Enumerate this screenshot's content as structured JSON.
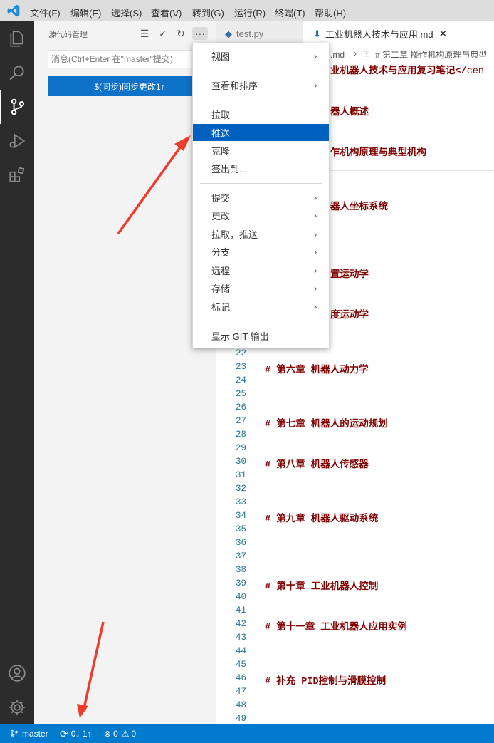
{
  "menubar": {
    "items": [
      "文件(F)",
      "编辑(E)",
      "选择(S)",
      "查看(V)",
      "转到(G)",
      "运行(R)",
      "终端(T)",
      "帮助(H)"
    ]
  },
  "sidebar": {
    "title": "源代码管理",
    "message_placeholder": "消息(Ctrl+Enter 在\"master\"提交)",
    "sync_button": "$(同步)同步更改1↑"
  },
  "tabs": [
    {
      "label": "test.py",
      "active": false
    },
    {
      "label": "工业机器人技术与应用.md",
      "active": true
    }
  ],
  "breadcrumb": {
    "file": "用.md",
    "separator": "›",
    "section": "# 第二章 操作机构原理与典型"
  },
  "editor": {
    "visible_fragments": [
      {
        "text": "业机器人技术与应用复习笔记</",
        "tail": "cen"
      },
      {
        "text": "器人概述"
      },
      {
        "text": "乍机构原理与典型机构"
      },
      {
        "text": "器人坐标系统"
      },
      {
        "text": "置运动学"
      },
      {
        "text": "度运动学"
      }
    ],
    "lines": [
      {
        "n": "22",
        "code": ""
      },
      {
        "n": "23",
        "code": "# 第六章 机器人动力学"
      },
      {
        "n": "24",
        "code": ""
      },
      {
        "n": "25",
        "code": ""
      },
      {
        "n": "26",
        "code": ""
      },
      {
        "n": "27",
        "code": "# 第七章 机器人的运动规划"
      },
      {
        "n": "28",
        "code": ""
      },
      {
        "n": "29",
        "code": ""
      },
      {
        "n": "30",
        "code": "# 第八章 机器人传感器"
      },
      {
        "n": "31",
        "code": ""
      },
      {
        "n": "32",
        "code": ""
      },
      {
        "n": "33",
        "code": ""
      },
      {
        "n": "34",
        "code": "# 第九章 机器人驱动系统"
      },
      {
        "n": "35",
        "code": ""
      },
      {
        "n": "36",
        "code": ""
      },
      {
        "n": "37",
        "code": ""
      },
      {
        "n": "38",
        "code": ""
      },
      {
        "n": "39",
        "code": "# 第十章 工业机器人控制"
      },
      {
        "n": "40",
        "code": ""
      },
      {
        "n": "41",
        "code": ""
      },
      {
        "n": "42",
        "code": "# 第十一章 工业机器人应用实例"
      },
      {
        "n": "43",
        "code": ""
      },
      {
        "n": "44",
        "code": ""
      },
      {
        "n": "45",
        "code": ""
      },
      {
        "n": "46",
        "code": "# 补充   PID控制与滑膜控制"
      },
      {
        "n": "47",
        "code": ""
      },
      {
        "n": "48",
        "code": ""
      },
      {
        "n": "49",
        "code": ""
      }
    ]
  },
  "context_menu": {
    "items": [
      {
        "label": "视图",
        "submenu": true
      },
      {
        "label": "查看和排序",
        "submenu": true
      },
      {
        "label": "拉取",
        "submenu": false
      },
      {
        "label": "推送",
        "submenu": false,
        "selected": true
      },
      {
        "label": "克隆",
        "submenu": false
      },
      {
        "label": "签出到...",
        "submenu": false
      },
      {
        "label": "提交",
        "submenu": true
      },
      {
        "label": "更改",
        "submenu": true
      },
      {
        "label": "拉取，推送",
        "submenu": true
      },
      {
        "label": "分支",
        "submenu": true
      },
      {
        "label": "远程",
        "submenu": true
      },
      {
        "label": "存储",
        "submenu": true
      },
      {
        "label": "标记",
        "submenu": true
      },
      {
        "label": "显示 GIT 输出",
        "submenu": false
      }
    ],
    "submenu_glyph": "›"
  },
  "statusbar": {
    "branch": "master",
    "sync": "0↓ 1↑",
    "errors": "0",
    "warnings": "0"
  },
  "colors": {
    "accent": "#007acc",
    "button": "#0e72c8",
    "menu_selected": "#0060c0",
    "arrow": "#ee3b2b",
    "heading_text": "#800000",
    "line_number": "#237893"
  }
}
